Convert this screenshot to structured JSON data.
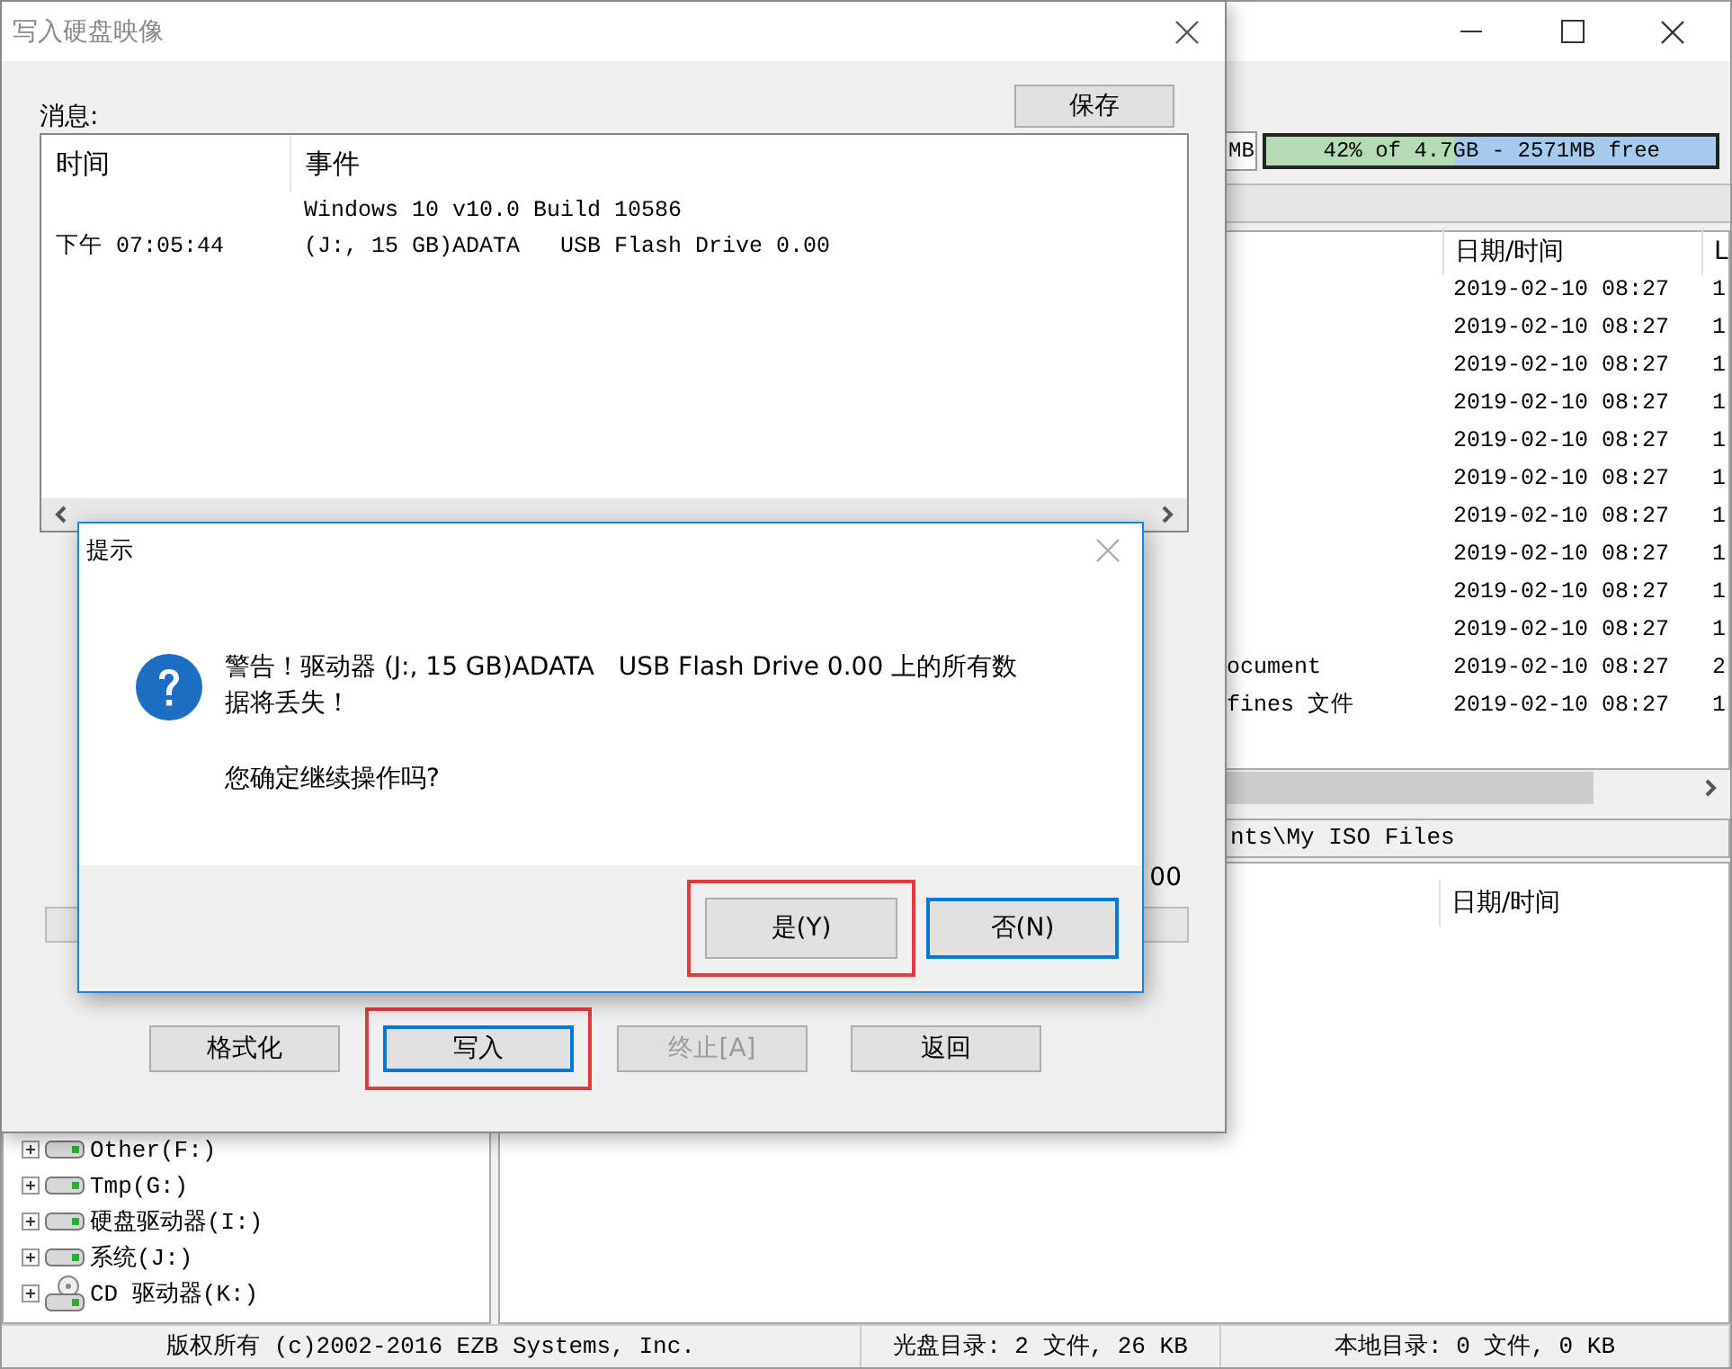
{
  "main_window": {
    "capacity": {
      "size_fragment": "MB",
      "label": "42% of 4.7GB - 2571MB free",
      "level": 0.42
    },
    "file_list": {
      "columns": [
        "日期/时间",
        "L"
      ],
      "rows": [
        {
          "date": "2019-02-10 08:27",
          "col_3": "1"
        },
        {
          "date": "2019-02-10 08:27",
          "col_3": "1"
        },
        {
          "date": "2019-02-10 08:27",
          "col_3": "1"
        },
        {
          "date": "2019-02-10 08:27",
          "col_3": "1"
        },
        {
          "date": "2019-02-10 08:27",
          "col_3": "1"
        },
        {
          "date": "2019-02-10 08:27",
          "col_3": "1"
        },
        {
          "date": "2019-02-10 08:27",
          "col_3": "1"
        },
        {
          "date": "2019-02-10 08:27",
          "col_3": "1"
        },
        {
          "date": "2019-02-10 08:27",
          "col_3": "1"
        },
        {
          "date": "2019-02-10 08:27",
          "col_3": "1"
        },
        {
          "name": "ocument",
          "date": "2019-02-10 08:27",
          "col_3": "2"
        },
        {
          "name": "fines 文件",
          "date": "2019-02-10 08:27",
          "col_3": "1"
        }
      ]
    },
    "path": "nts\\My ISO Files",
    "local_list": {
      "columns": [
        "日期/时间"
      ]
    },
    "tree": [
      {
        "label": "Other(F:)",
        "kind": "disk",
        "expanded": false
      },
      {
        "label": "Tmp(G:)",
        "kind": "disk",
        "expanded": false
      },
      {
        "label": "硬盘驱动器(I:)",
        "kind": "disk",
        "expanded": false
      },
      {
        "label": "系统(J:)",
        "kind": "disk",
        "expanded": false
      },
      {
        "label": "CD 驱动器(K:)",
        "kind": "cd",
        "expanded": false
      }
    ],
    "status_bar": [
      "版权所有 (c)2002-2016 EZB Systems, Inc.",
      "光盘目录: 2 文件, 26 KB",
      "本地目录: 0 文件, 0 KB"
    ]
  },
  "write_dialog": {
    "title": "写入硬盘映像",
    "messages_label": "消息:",
    "save_button": "保存",
    "log": {
      "columns": [
        "时间",
        "事件"
      ],
      "rows": [
        {
          "event": "Windows 10 v10.0 Build 10586"
        },
        {
          "time": "下午 07:05:44",
          "event": "(J:, 15 GB)ADATA   USB Flash Drive 0.00"
        }
      ]
    },
    "value_fragment": "00",
    "progress": {
      "level": 0
    },
    "buttons": [
      {
        "label": "格式化",
        "disabled": false,
        "focused": false,
        "highlighted": false
      },
      {
        "label": "写入",
        "disabled": false,
        "focused": true,
        "highlighted": true
      },
      {
        "label": "终止[A]",
        "disabled": true,
        "focused": false,
        "highlighted": false
      },
      {
        "label": "返回",
        "disabled": false,
        "focused": false,
        "highlighted": false
      }
    ]
  },
  "message_box": {
    "title": "提示",
    "message": "警告！驱动器 (J:, 15 GB)ADATA   USB Flash Drive 0.00 上的所有数据将丢失！",
    "question": "您确定继续操作吗?",
    "buttons": [
      {
        "label": "是(Y)",
        "focused": false,
        "highlighted": true
      },
      {
        "label": "否(N)",
        "focused": true,
        "highlighted": false
      }
    ]
  }
}
